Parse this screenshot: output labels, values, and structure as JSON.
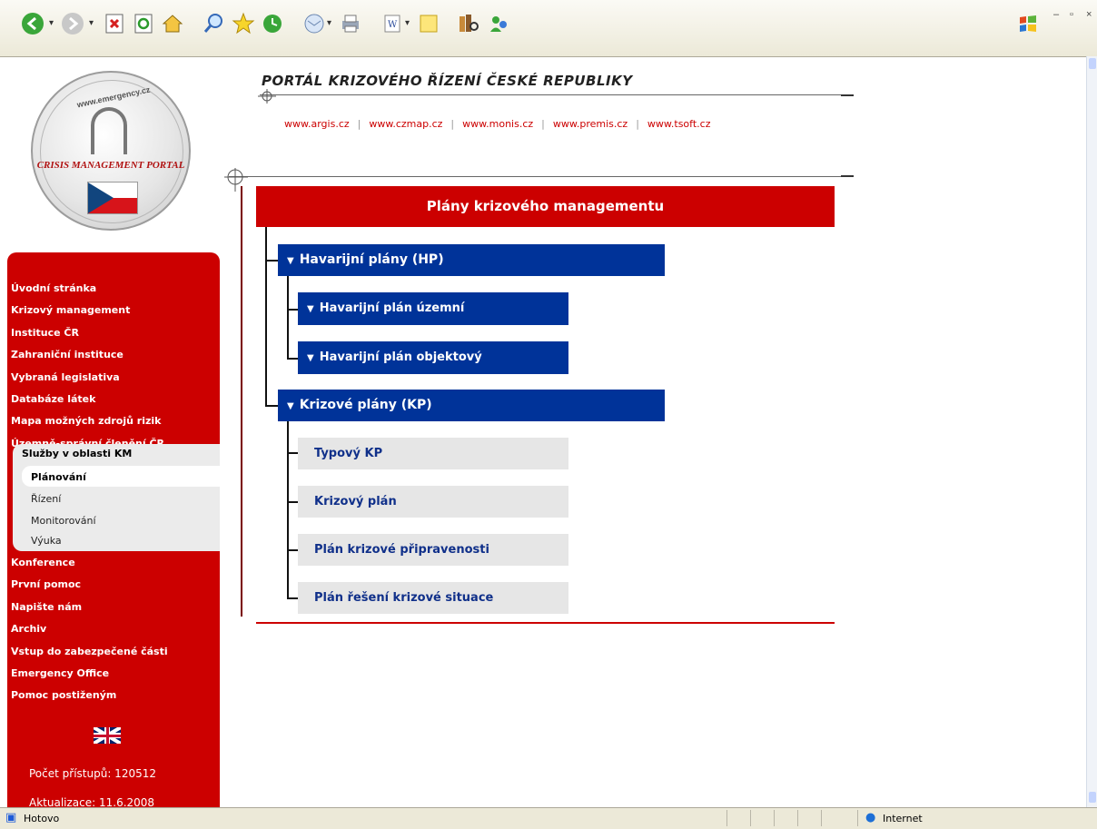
{
  "browser": {
    "toolbar_icons": [
      "back-icon",
      "forward-icon",
      "stop-icon",
      "refresh-icon",
      "home-icon",
      "search-icon",
      "favorites-icon",
      "history-icon",
      "mail-icon",
      "print-icon",
      "edit-icon",
      "notes-icon",
      "research-icon",
      "messenger-icon"
    ],
    "status_text": "Hotovo",
    "zone_text": "Internet"
  },
  "header": {
    "portal_title": "PORTÁL KRIZOVÉHO ŘÍZENÍ ČESKÉ REPUBLIKY",
    "links": [
      "www.argis.cz",
      "www.czmap.cz",
      "www.monis.cz",
      "www.premis.cz",
      "www.tsoft.cz"
    ],
    "logo_text": "CRISIS MANAGEMENT PORTAL",
    "logo_url": "www.emergency.cz"
  },
  "sidebar": {
    "menu_top": [
      "Úvodní stránka",
      "Krizový management",
      "Instituce ČR",
      "Zahraniční instituce",
      "Vybraná legislativa",
      "Databáze látek",
      "Mapa možných zdrojů rizik",
      "Územně-správní členění ČR"
    ],
    "submenu_head": "Služby v oblasti KM",
    "submenu": [
      "Plánování",
      "Řízení",
      "Monitorování",
      "Výuka"
    ],
    "menu_bottom": [
      "Konference",
      "První pomoc",
      "Napište nám",
      "Archiv",
      "Vstup do zabezpečené části",
      "Emergency Office",
      "Pomoc postiženým"
    ],
    "counter": "Počet přístupů: 120512",
    "updated": "Aktualizace: 11.6.2008"
  },
  "main": {
    "heading": "Plány krizového managementu",
    "hp": "Havarijní plány (HP)",
    "hp_children": [
      "Havarijní plán územní",
      "Havarijní plán objektový"
    ],
    "kp": "Krizové plány (KP)",
    "kp_children": [
      "Typový KP",
      "Krizový plán",
      "Plán krizové připravenosti",
      "Plán řešení krizové situace"
    ]
  },
  "colors": {
    "red": "#cc0000",
    "blue": "#003399",
    "grey": "#e6e6e6"
  }
}
